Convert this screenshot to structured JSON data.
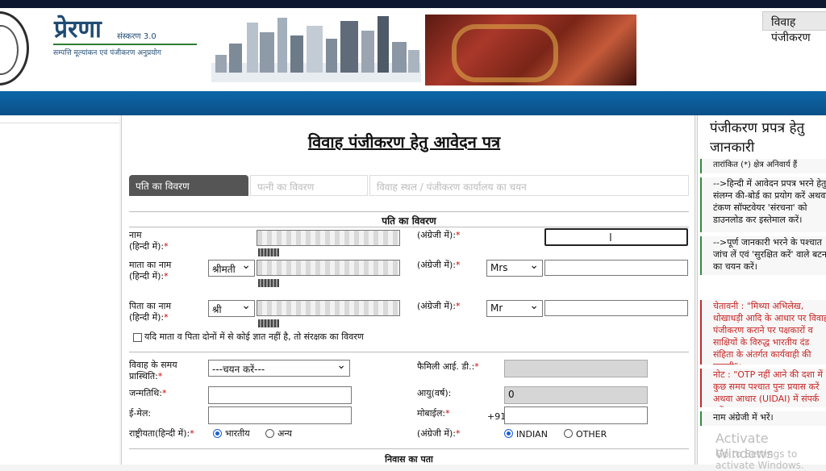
{
  "header": {
    "logo_title": "प्रेरणा",
    "logo_version": "संस्करण 3.0",
    "logo_subtitle": "सम्पत्ति मूल्यांकन एवं पंजीकरण अनुप्रयोग",
    "right_tab": "विवाह पंजीकरण"
  },
  "form": {
    "title": "विवाह पंजीकरण हेतु आवेदन पत्र",
    "tabs": [
      "पति का विवरण",
      "पत्नी का विवरण",
      "विवाह स्थल / पंजीकरण कार्यालय का चयन"
    ],
    "section1_heading": "पति का विवरण",
    "name_label": "नाम\n(हिन्दी में):",
    "english_label": "(अंग्रेजी में):",
    "mother_label": "माता का नाम\n(हिन्दी में):",
    "mother_prefix": "श्रीमती",
    "mother_en_prefix": "Mrs",
    "father_label": "पिता का नाम\n(हिन्दी में):",
    "father_prefix": "श्री",
    "father_en_prefix": "Mr",
    "guardian_checkbox": "यदि माता व पिता दोनों में से कोई ज्ञात नहीं है, तो संरक्षक का विवरण",
    "status_label": "विवाह के समय\nप्रास्थिति:",
    "status_select": "---चयन करें---",
    "family_id_label": "फैमिली आई. डी.:",
    "dob_label": "जन्मतिथि:",
    "age_label": "आयु(वर्ष):",
    "age_value": "0",
    "email_label": "ई-मेल:",
    "mobile_label": "मोबाईल:",
    "mobile_code": "+91",
    "nationality_label": "राष्ट्रीयता(हिन्दी में):",
    "nat_hi_options": [
      "भारतीय",
      "अन्य"
    ],
    "nat_en_options": [
      "INDIAN",
      "OTHER"
    ],
    "section2_heading": "निवास का पता"
  },
  "info_panel": {
    "title": "पंजीकरण प्रपत्र हेतु जानकारी",
    "note_required": "तारांकित (*) क्षेत्र अनिवार्य हैं",
    "tip1": "-->हिन्दी में आवेदन प्रपत्र भरने हेतु संलग्न की-बोर्ड का प्रयोग करें अथवा टंकण सॉफ्टवेयर 'संरचना' को डाउनलोड कर इस्तेमाल करें।",
    "tip2": "-->पूर्ण जानकारी भरने के पश्चात जांच लें एवं 'सुरक्षित करें' वाले बटन का चयन करें।",
    "warning": "चेतावनी : \"मिथ्या अभिलेख, धोखाधड़ी आदि के आधार पर विवाह पंजीकरण कराने पर पक्षकारों व साक्षियों के विरुद्ध भारतीय दंड संहिता के अंतर्गत कार्यवाही की जाएगी\"।",
    "otp_note": "नोट : \"OTP नहीं आने की दशा में कुछ समय पश्चात पुनः प्रयास करें अथवा आधार (UIDAI) में संपर्क करें\"।",
    "english_note": "नाम अंग्रेजी में भरें।"
  },
  "watermark": {
    "line1": "Activate Windows",
    "line2": "Go to Settings to activate Windows."
  }
}
